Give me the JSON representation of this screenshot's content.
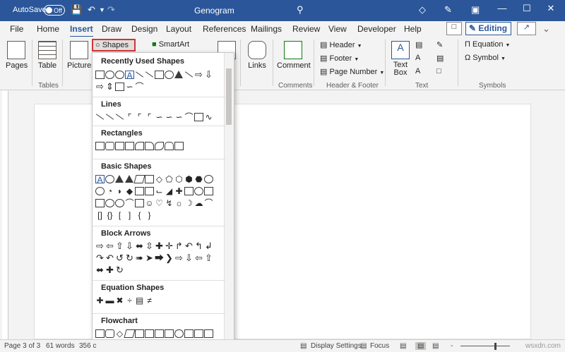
{
  "titlebar": {
    "autosave_label": "AutoSave",
    "autosave_state": "Off",
    "doc_title": "Genogram"
  },
  "tabs": [
    "File",
    "Home",
    "Insert",
    "Draw",
    "Design",
    "Layout",
    "References",
    "Mailings",
    "Review",
    "View",
    "Developer",
    "Help"
  ],
  "active_tab": "Insert",
  "editing_label": "Editing",
  "ribbon": {
    "pages": "Pages",
    "table": "Table",
    "tables_group": "Tables",
    "pictures": "Pictures",
    "shapes": "Shapes",
    "smartart": "SmartArt",
    "links": "Links",
    "comment": "Comment",
    "comments_group": "Comments",
    "header": "Header",
    "footer": "Footer",
    "page_number": "Page Number",
    "header_footer_group": "Header & Footer",
    "text_box": "Text Box",
    "text_group": "Text",
    "equation": "Equation",
    "symbol": "Symbol",
    "symbols_group": "Symbols"
  },
  "shapes_menu": {
    "sections": [
      {
        "title": "Recently Used Shapes"
      },
      {
        "title": "Lines"
      },
      {
        "title": "Rectangles"
      },
      {
        "title": "Basic Shapes"
      },
      {
        "title": "Block Arrows"
      },
      {
        "title": "Equation Shapes"
      },
      {
        "title": "Flowchart"
      }
    ]
  },
  "statusbar": {
    "page": "Page 3 of 3",
    "words": "61 words",
    "trunc": "356 c",
    "display_settings": "Display Settings",
    "focus": "Focus",
    "zoom": "-"
  },
  "watermark": "wsxdn.com"
}
